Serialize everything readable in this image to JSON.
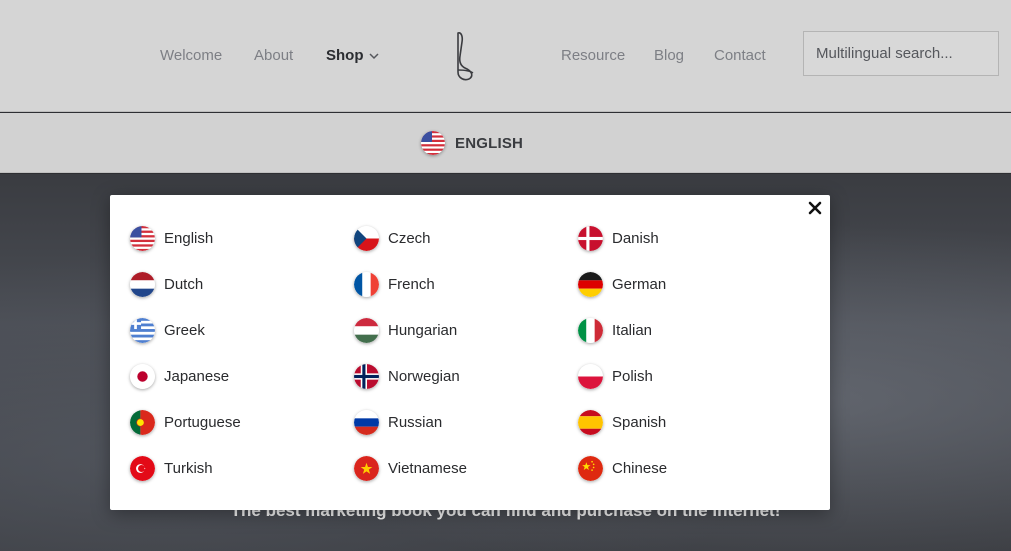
{
  "header": {
    "nav_left": [
      "Welcome",
      "About",
      "Shop"
    ],
    "nav_right": [
      "Resource",
      "Blog",
      "Contact"
    ],
    "active": "Shop",
    "search_placeholder": "Multilingual search..."
  },
  "language_bar": {
    "current_label": "ENGLISH",
    "current_flag": "us-flag-icon"
  },
  "hero": {
    "tagline": "The best marketing book you can find and purchase on the internet!"
  },
  "language_modal": {
    "close_icon": "close-icon",
    "languages": [
      [
        "English",
        "Czech",
        "Danish"
      ],
      [
        "Dutch",
        "French",
        "German"
      ],
      [
        "Greek",
        "Hungarian",
        "Italian"
      ],
      [
        "Japanese",
        "Norwegian",
        "Polish"
      ],
      [
        "Portuguese",
        "Russian",
        "Spanish"
      ],
      [
        "Turkish",
        "Vietnamese",
        "Chinese"
      ]
    ]
  },
  "colors": {
    "header_bg": "#d5d5d5",
    "nav_text": "#7d7f85",
    "nav_active": "#2b2d31",
    "modal_bg": "#ffffff"
  }
}
